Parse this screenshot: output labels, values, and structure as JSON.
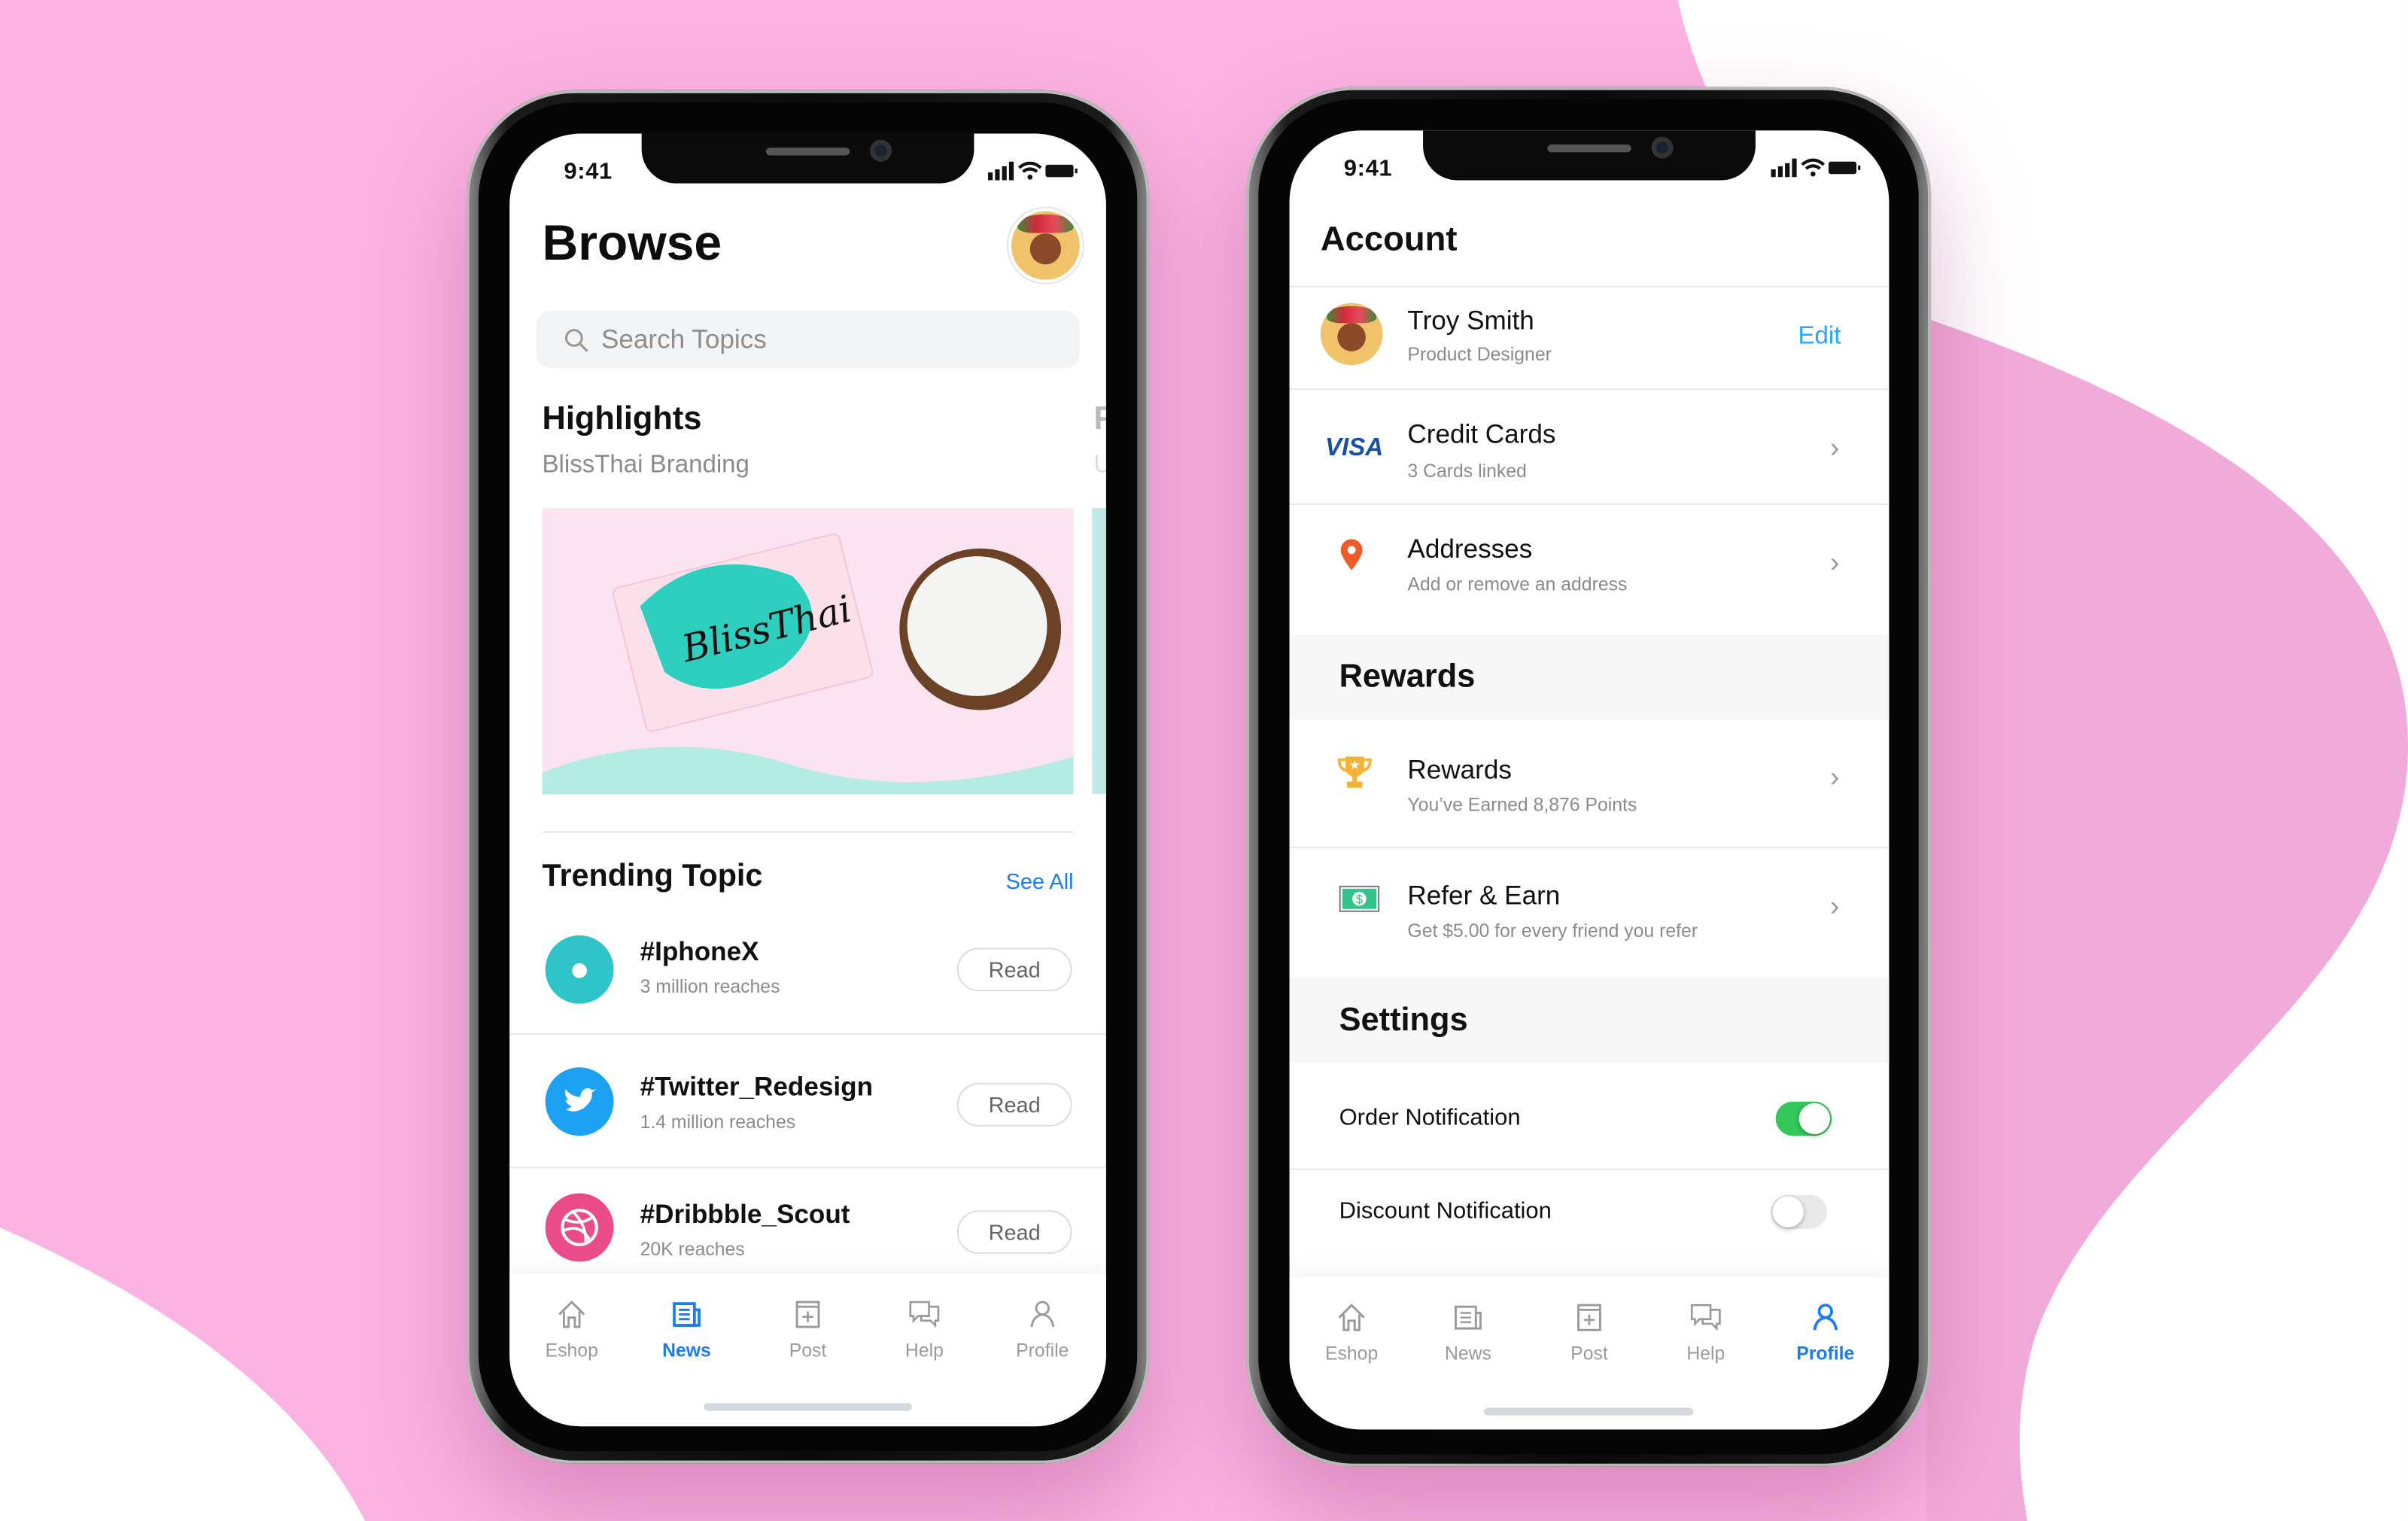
{
  "colors": {
    "background_pink": "#fbb3e3",
    "accent_blue": "#1a7cf0",
    "edit_blue": "#2aa6f0",
    "toggle_on": "#34c759",
    "pin": "#f05a28"
  },
  "browse_phone": {
    "status_time": "9:41",
    "title": "Browse",
    "search_placeholder": "Search Topics",
    "highlight": {
      "title": "Highlights",
      "subtitle": "BlissThai Branding",
      "image_logo_text": "BlissThai",
      "next_title_peek": "F",
      "next_subtitle_peek": "U"
    },
    "trending": {
      "title": "Trending Topic",
      "see_all": "See All",
      "items": [
        {
          "title": "#IphoneX",
          "subtitle": "3 million reaches",
          "button": "Read",
          "icon": "apple-icon",
          "color": "#2ec4c9"
        },
        {
          "title": "#Twitter_Redesign",
          "subtitle": "1.4 million reaches",
          "button": "Read",
          "icon": "twitter-icon",
          "color": "#1da1f2"
        },
        {
          "title": "#Dribbble_Scout",
          "subtitle": "20K reaches",
          "button": "Read",
          "icon": "dribbble-icon",
          "color": "#ea4c89"
        }
      ]
    },
    "tabs": [
      {
        "label": "Eshop",
        "icon": "home-icon"
      },
      {
        "label": "News",
        "icon": "news-icon",
        "active": true
      },
      {
        "label": "Post",
        "icon": "post-icon"
      },
      {
        "label": "Help",
        "icon": "chat-icon"
      },
      {
        "label": "Profile",
        "icon": "user-icon"
      }
    ]
  },
  "account_phone": {
    "status_time": "9:41",
    "title": "Account",
    "profile": {
      "name": "Troy Smith",
      "role": "Product Designer",
      "edit": "Edit"
    },
    "rows": [
      {
        "title": "Credit Cards",
        "subtitle": "3 Cards linked",
        "icon": "visa-icon",
        "icon_text": "VISA"
      },
      {
        "title": "Addresses",
        "subtitle": "Add or remove an address",
        "icon": "map-pin-icon"
      }
    ],
    "rewards_section": {
      "title": "Rewards",
      "rows": [
        {
          "title": "Rewards",
          "subtitle": "You’ve Earned 8,876 Points",
          "icon": "trophy-icon"
        },
        {
          "title": "Refer & Earn",
          "subtitle": "Get $5.00 for every friend you refer",
          "icon": "money-icon"
        }
      ]
    },
    "settings_section": {
      "title": "Settings",
      "toggles": [
        {
          "label": "Order Notification",
          "on": true
        },
        {
          "label": "Discount Notification",
          "on": false
        }
      ]
    },
    "tabs": [
      {
        "label": "Eshop",
        "icon": "home-icon"
      },
      {
        "label": "News",
        "icon": "news-icon"
      },
      {
        "label": "Post",
        "icon": "post-icon"
      },
      {
        "label": "Help",
        "icon": "chat-icon"
      },
      {
        "label": "Profile",
        "icon": "user-icon",
        "active": true
      }
    ]
  }
}
